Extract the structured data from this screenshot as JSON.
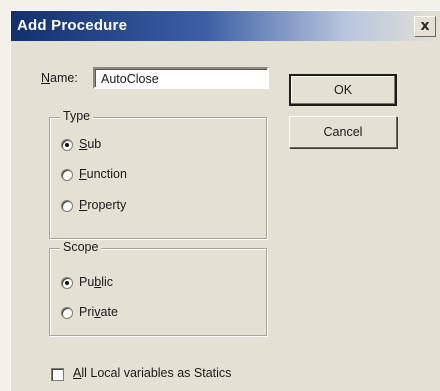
{
  "window": {
    "title": "Add Procedure",
    "close_glyph": "x"
  },
  "name_field": {
    "label": "Name:",
    "mnemonic": "N",
    "rest": "ame:",
    "value": "AutoClose"
  },
  "buttons": {
    "ok": "OK",
    "cancel": "Cancel"
  },
  "type_group": {
    "legend": "Type",
    "options": [
      {
        "label": "Sub",
        "mnemonic": "S",
        "rest": "ub",
        "selected": true
      },
      {
        "label": "Function",
        "mnemonic": "F",
        "rest": "unction",
        "selected": false
      },
      {
        "label": "Property",
        "mnemonic": "P",
        "rest": "roperty",
        "selected": false
      }
    ]
  },
  "scope_group": {
    "legend": "Scope",
    "options": [
      {
        "label": "Public",
        "pre": "Pu",
        "mnemonic": "b",
        "rest": "lic",
        "selected": true
      },
      {
        "label": "Private",
        "pre": "Pri",
        "mnemonic": "v",
        "rest": "ate",
        "selected": false
      }
    ]
  },
  "statics_checkbox": {
    "label": "All Local variables as Statics",
    "mnemonic": "A",
    "rest": "ll Local variables as Statics",
    "checked": false
  }
}
